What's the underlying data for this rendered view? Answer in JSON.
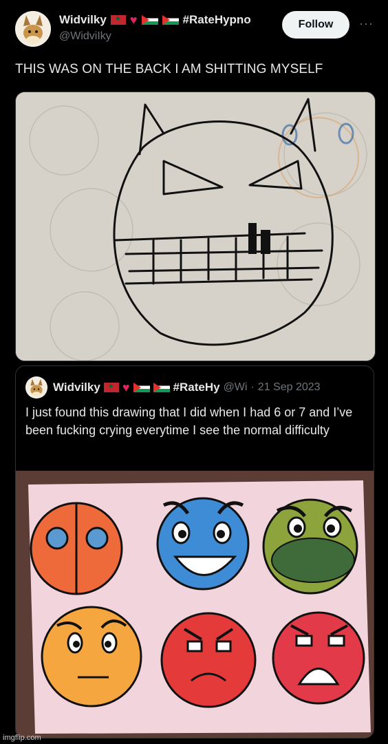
{
  "post": {
    "author_name": "Widvilky",
    "hashtag": "#RateHypno",
    "handle": "@WidviIky",
    "follow_label": "Follow",
    "more_label": "···",
    "text": "THIS WAS ON THE BACK I AM SHITTING MYSELF"
  },
  "quote": {
    "author_name": "Widvilky",
    "hashtag": "#RateHy",
    "handle": "@Wi",
    "separator": "·",
    "date": "21 Sep 2023",
    "text": "I just found this drawing that I did when I had 6 or 7 and I’ve been fucking crying everytime I see the normal difficulty"
  },
  "watermark": "imgflip.com",
  "colors": {
    "background": "#000000",
    "text": "#e7e9ea",
    "muted": "#71767b",
    "follow_bg": "#eff3f4"
  }
}
